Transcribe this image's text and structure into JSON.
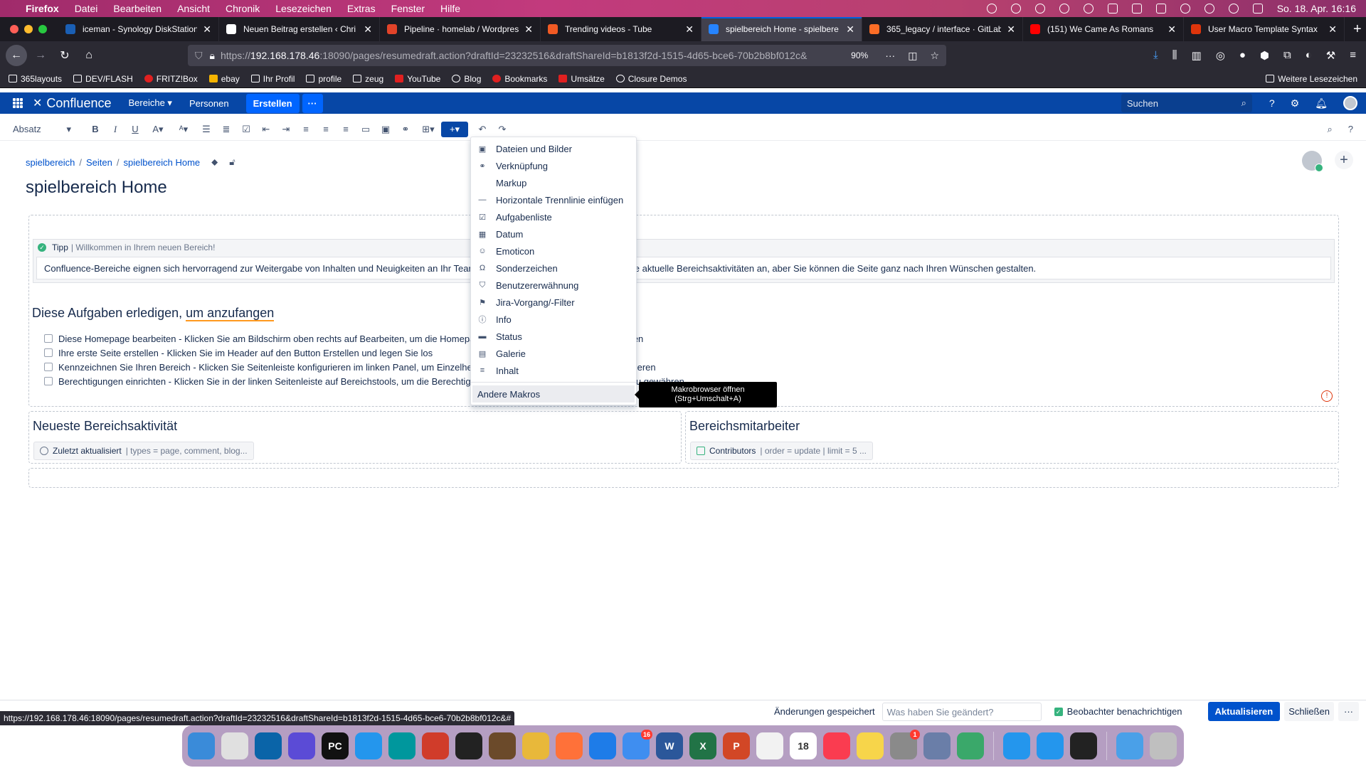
{
  "menubar": {
    "app": "Firefox",
    "items": [
      "Datei",
      "Bearbeiten",
      "Ansicht",
      "Chronik",
      "Lesezeichen",
      "Extras",
      "Fenster",
      "Hilfe"
    ],
    "clock": "So. 18. Apr.  16:16"
  },
  "tabs": [
    {
      "title": "iceman - Synology DiskStation",
      "color": "#1a5fb4"
    },
    {
      "title": "Neuen Beitrag erstellen ‹ Chri",
      "color": "#ffffff"
    },
    {
      "title": "Pipeline · homelab / Wordpres",
      "color": "#e24329"
    },
    {
      "title": "Trending videos - Tube",
      "color": "#f15a24"
    },
    {
      "title": "spielbereich Home - spielbere",
      "color": "#2684ff"
    },
    {
      "title": "365_legacy / interface · GitLab",
      "color": "#fc6d26"
    },
    {
      "title": "(151) We Came As Romans",
      "color": "#ff0000"
    },
    {
      "title": "User Macro Template Syntax",
      "color": "#de350b"
    }
  ],
  "active_tab_index": 4,
  "url": {
    "prefix": "https://",
    "host": "192.168.178.46",
    "rest": ":18090/pages/resumedraft.action?draftId=23232516&draftShareId=b1813f2d-1515-4d65-bce6-70b2b8bf012c&",
    "zoom": "90%"
  },
  "bookmarks": [
    {
      "label": "365layouts",
      "icon": "folder"
    },
    {
      "label": "DEV/FLASH",
      "icon": "folder"
    },
    {
      "label": "FRITZ!Box",
      "icon": "fritz"
    },
    {
      "label": "ebay",
      "icon": "ebay"
    },
    {
      "label": "Ihr Profil",
      "icon": "amazon"
    },
    {
      "label": "profile",
      "icon": "folder"
    },
    {
      "label": "zeug",
      "icon": "folder"
    },
    {
      "label": "YouTube",
      "icon": "youtube"
    },
    {
      "label": "Blog",
      "icon": "globe"
    },
    {
      "label": "Bookmarks",
      "icon": "bookmarks"
    },
    {
      "label": "Umsätze",
      "icon": "umsatz"
    },
    {
      "label": "Closure Demos",
      "icon": "globe"
    }
  ],
  "bookmarks_more": "Weitere Lesezeichen",
  "confluence": {
    "logo": "Confluence",
    "nav": [
      "Bereiche",
      "Personen"
    ],
    "create": "Erstellen",
    "more": "···",
    "search_placeholder": "Suchen"
  },
  "editor": {
    "paragraph": "Absatz"
  },
  "breadcrumbs": [
    "spielbereich",
    "Seiten",
    "spielbereich Home"
  ],
  "page_title": "spielbereich Home",
  "tip": {
    "title": "Tipp",
    "subtitle": "| Willkommen in Ihrem neuen Bereich!",
    "body": "Confluence-Bereiche eignen sich hervorragend zur Weitergabe von Inhalten und Neuigkeiten an Ihr Tear",
    "body_end": "eigt sie aktuelle Bereichsaktivitäten an, aber Sie können die Seite ganz nach Ihren Wünschen gestalten."
  },
  "tasks": {
    "heading_a": "Diese Aufgaben erledigen, ",
    "heading_b": "um anzufangen",
    "items": [
      {
        "a": "Diese Homepage bearbeiten - Klicken Sie am Bildschirm oben rechts auf Bearbeiten, um die Homepa",
        "b": "sen"
      },
      {
        "a": "Ihre erste Seite erstellen - Klicken Sie im Header auf den Button Erstellen und legen Sie los",
        "b": ""
      },
      {
        "a": "Kennzeichnen Sie Ihren Bereich - Klicken Sie Seitenleiste konfigurieren im linken Panel, um Einzelheit",
        "b": "sieren"
      },
      {
        "a": "Berechtigungen einrichten - Klicken Sie in der linken Seitenleiste auf Bereichstools, um die Berechtig",
        "b": "riff zu gewähren"
      }
    ]
  },
  "activity": {
    "heading": "Neueste Bereichsaktivität",
    "macro_title": "Zuletzt aktualisiert",
    "macro_params": "| types = page, comment, blog..."
  },
  "contributors": {
    "heading": "Bereichsmitarbeiter",
    "macro_title": "Contributors",
    "macro_params": "| order = update | limit = 5 ..."
  },
  "insert_menu": {
    "items": [
      {
        "label": "Dateien und Bilder",
        "icon": "image-icon"
      },
      {
        "label": "Verknüpfung",
        "icon": "link-icon"
      },
      {
        "label": "Markup",
        "icon": "code-icon"
      },
      {
        "label": "Horizontale Trennlinie einfügen",
        "icon": "rule-icon"
      },
      {
        "label": "Aufgabenliste",
        "icon": "checkbox-icon"
      },
      {
        "label": "Datum",
        "icon": "calendar-icon"
      },
      {
        "label": "Emoticon",
        "icon": "smiley-icon"
      },
      {
        "label": "Sonderzeichen",
        "icon": "omega-icon"
      },
      {
        "label": "Benutzererwähnung",
        "icon": "user-icon"
      },
      {
        "label": "Jira-Vorgang/-Filter",
        "icon": "jira-icon"
      },
      {
        "label": "Info",
        "icon": "info-icon"
      },
      {
        "label": "Status",
        "icon": "status-icon"
      },
      {
        "label": "Galerie",
        "icon": "gallery-icon"
      },
      {
        "label": "Inhalt",
        "icon": "toc-icon"
      }
    ],
    "other": "Andere Makros",
    "tooltip_line1": "Makrobrowser öffnen",
    "tooltip_line2": "(Strg+Umschalt+A)"
  },
  "savebar": {
    "saved": "Änderungen gespeichert",
    "comment_placeholder": "Was haben Sie geändert?",
    "notify": "Beobachter benachrichtigen",
    "update": "Aktualisieren",
    "close": "Schließen",
    "more": "···"
  },
  "status_url": "https://192.168.178.46:18090/pages/resumedraft.action?draftId=23232516&draftShareId=b1813f2d-1515-4d65-bce6-70b2b8bf012c&#",
  "dock": [
    {
      "name": "finder",
      "color": "#3a8bd9",
      "label": ""
    },
    {
      "name": "launchpad",
      "color": "#e0e0e0",
      "label": ""
    },
    {
      "name": "vscode",
      "color": "#0a64a8",
      "label": ""
    },
    {
      "name": "remote",
      "color": "#5b4bd6",
      "label": ""
    },
    {
      "name": "pycharm",
      "color": "#111111",
      "label": "PC"
    },
    {
      "name": "docker",
      "color": "#2496ed",
      "label": ""
    },
    {
      "name": "arduino",
      "color": "#00979d",
      "label": ""
    },
    {
      "name": "git",
      "color": "#d03c2a",
      "label": ""
    },
    {
      "name": "terminal",
      "color": "#222222",
      "label": ""
    },
    {
      "name": "calibre",
      "color": "#6b4a2a",
      "label": ""
    },
    {
      "name": "chrome",
      "color": "#e8b83a",
      "label": ""
    },
    {
      "name": "firefox",
      "color": "#ff7139",
      "label": ""
    },
    {
      "name": "safari",
      "color": "#1e7ce8",
      "label": ""
    },
    {
      "name": "mail",
      "color": "#3f8ef0",
      "label": "",
      "badge": "16"
    },
    {
      "name": "word",
      "color": "#2b579a",
      "label": "W"
    },
    {
      "name": "excel",
      "color": "#217346",
      "label": "X"
    },
    {
      "name": "powerpoint",
      "color": "#d24726",
      "label": "P"
    },
    {
      "name": "photos",
      "color": "#f2f2f2",
      "label": ""
    },
    {
      "name": "calendar",
      "color": "#ffffff",
      "label": "18"
    },
    {
      "name": "music",
      "color": "#fa3c50",
      "label": ""
    },
    {
      "name": "notes",
      "color": "#f7d54a",
      "label": ""
    },
    {
      "name": "preferences",
      "color": "#8a8a8a",
      "label": "",
      "badge": "1"
    },
    {
      "name": "preview",
      "color": "#6a7ea8",
      "label": ""
    },
    {
      "name": "box",
      "color": "#3aa86a",
      "label": ""
    },
    {
      "name": "docker2",
      "color": "#2496ed",
      "label": ""
    },
    {
      "name": "docker3",
      "color": "#2496ed",
      "label": ""
    },
    {
      "name": "terminal2",
      "color": "#222222",
      "label": ""
    },
    {
      "name": "downloads",
      "color": "#4aa0e8",
      "label": ""
    },
    {
      "name": "trash",
      "color": "#bfbfbf",
      "label": ""
    }
  ]
}
